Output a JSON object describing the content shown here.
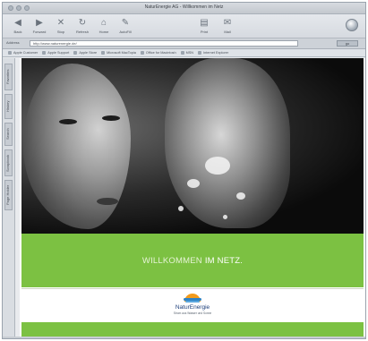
{
  "browser": {
    "window_title": "NaturEnergie AG - Willkommen im Netz",
    "toolbar": [
      {
        "label": "Back",
        "icon": "back-arrow-icon"
      },
      {
        "label": "Forward",
        "icon": "forward-arrow-icon"
      },
      {
        "label": "Stop",
        "icon": "stop-icon"
      },
      {
        "label": "Refresh",
        "icon": "refresh-icon"
      },
      {
        "label": "Home",
        "icon": "home-icon"
      },
      {
        "label": "AutoFill",
        "icon": "autofill-icon"
      },
      {
        "label": "Print",
        "icon": "print-icon"
      },
      {
        "label": "Mail",
        "icon": "mail-icon"
      }
    ],
    "address": {
      "label": "Address",
      "url": "http://www.naturenergie.de/",
      "go_label": "go"
    },
    "favorites": [
      "Apple Customer",
      "Apple Support",
      "Apple Store",
      "Microsoft MacTopia",
      "Office for Macintosh",
      "MSN",
      "Internet Explorer"
    ],
    "sidebar_tabs": [
      "Favorites",
      "History",
      "Search",
      "Scrapbook",
      "Page Holder"
    ]
  },
  "site": {
    "welcome_part1": "WILLKOMMEN",
    "welcome_part2": "IM NETZ.",
    "brand_name": "NaturEnergie",
    "brand_tagline": "Strom aus Wasser und Sonne"
  },
  "colors": {
    "accent_green": "#7cc142",
    "sun_orange": "#f29b1c",
    "water_blue": "#2f83c5",
    "brand_navy": "#1d3f7a"
  }
}
